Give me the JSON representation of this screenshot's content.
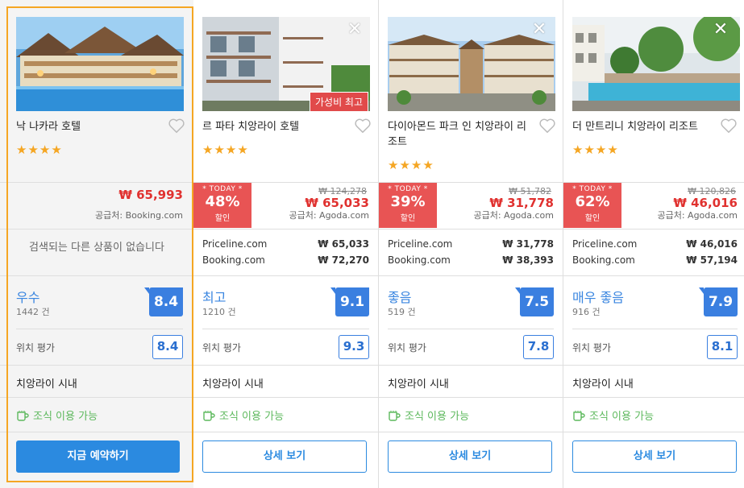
{
  "cards": [
    {
      "name": "낙 나카라 호텔",
      "stars": "★★★★",
      "price": "₩ 65,993",
      "supplier": "공급처: Booking.com",
      "no_results": "검색되는 다른 상품이 없습니다",
      "rating_word": "우수",
      "rating_count": "1442 건",
      "score": "8.4",
      "location_label": "위치 평가",
      "location_score": "8.4",
      "district": "치앙라이 시내",
      "breakfast": "조식 이용 가능",
      "button": "지금 예약하기"
    },
    {
      "name": "르 파타 치앙라이 호텔",
      "stars": "★★★★",
      "badge": "가성비 최고",
      "today": "* TODAY *",
      "discount": "48%",
      "discount_label": "할인",
      "original_price": "₩ 124,278",
      "price": "₩ 65,033",
      "supplier": "공급처: Agoda.com",
      "alternatives": [
        {
          "site": "Priceline.com",
          "price": "₩ 65,033"
        },
        {
          "site": "Booking.com",
          "price": "₩ 72,270"
        }
      ],
      "rating_word": "최고",
      "rating_count": "1210 건",
      "score": "9.1",
      "location_label": "위치 평가",
      "location_score": "9.3",
      "district": "치앙라이 시내",
      "breakfast": "조식 이용 가능",
      "button": "상세 보기"
    },
    {
      "name": "다이아몬드 파크 인 치앙라이 리조트",
      "stars": "★★★★",
      "today": "* TODAY *",
      "discount": "39%",
      "discount_label": "할인",
      "original_price": "₩ 51,782",
      "price": "₩ 31,778",
      "supplier": "공급처: Agoda.com",
      "alternatives": [
        {
          "site": "Priceline.com",
          "price": "₩ 31,778"
        },
        {
          "site": "Booking.com",
          "price": "₩ 38,393"
        }
      ],
      "rating_word": "좋음",
      "rating_count": "519 건",
      "score": "7.5",
      "location_label": "위치 평가",
      "location_score": "7.8",
      "district": "치앙라이 시내",
      "breakfast": "조식 이용 가능",
      "button": "상세 보기"
    },
    {
      "name": "더 만트리니 치앙라이 리조트",
      "stars": "★★★★",
      "today": "* TODAY *",
      "discount": "62%",
      "discount_label": "할인",
      "original_price": "₩ 120,826",
      "price": "₩ 46,016",
      "supplier": "공급처: Agoda.com",
      "alternatives": [
        {
          "site": "Priceline.com",
          "price": "₩ 46,016"
        },
        {
          "site": "Booking.com",
          "price": "₩ 57,194"
        }
      ],
      "rating_word": "매우 좋음",
      "rating_count": "916 건",
      "score": "7.9",
      "location_label": "위치 평가",
      "location_score": "8.1",
      "district": "치앙라이 시내",
      "breakfast": "조식 이용 가능",
      "button": "상세 보기"
    }
  ],
  "colors": {
    "accent": "#2b8ae0",
    "price_red": "#e0312f",
    "discount_box": "#e85454",
    "selected_border": "#f5a623",
    "star": "#f5a623",
    "breakfast_green": "#5cb85c"
  },
  "icons": [
    "close-icon",
    "heart-icon",
    "star-icon",
    "cup-icon"
  ]
}
